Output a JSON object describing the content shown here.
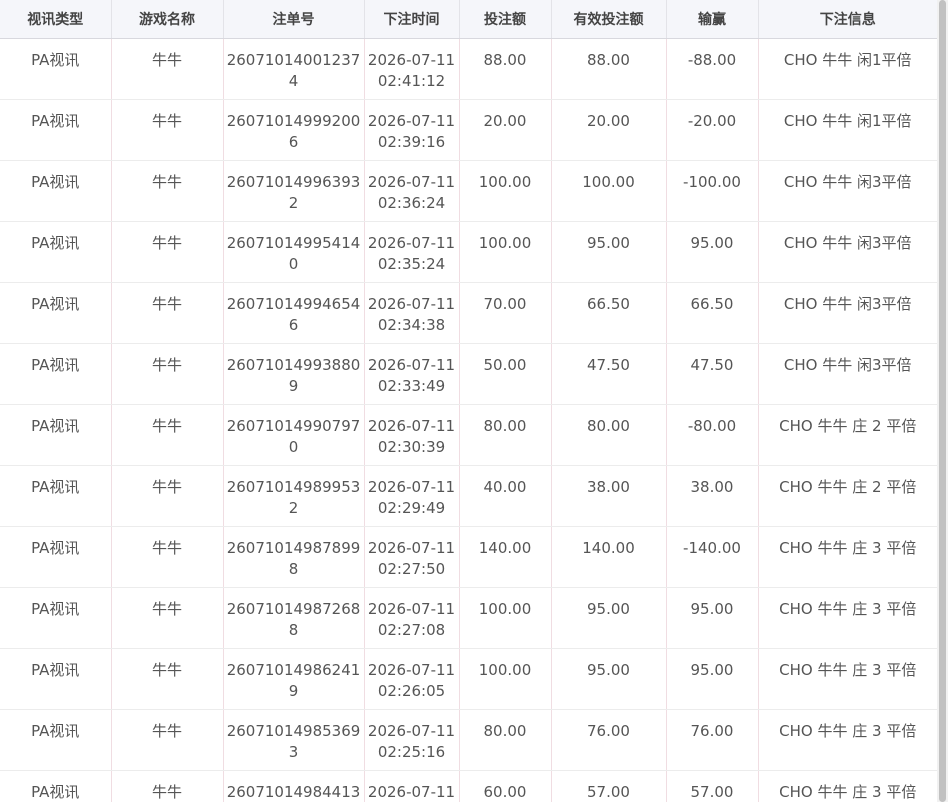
{
  "columns": [
    "视讯类型",
    "游戏名称",
    "注单号",
    "下注时间",
    "投注额",
    "有效投注额",
    "输赢",
    "下注信息"
  ],
  "rows": [
    {
      "type": "PA视讯",
      "game": "牛牛",
      "bet_id": "260710140012374",
      "time": "2026-07-11 02:41:12",
      "amount": "88.00",
      "valid": "88.00",
      "winloss": "-88.00",
      "info": "CHO 牛牛 闲1平倍"
    },
    {
      "type": "PA视讯",
      "game": "牛牛",
      "bet_id": "260710149992006",
      "time": "2026-07-11 02:39:16",
      "amount": "20.00",
      "valid": "20.00",
      "winloss": "-20.00",
      "info": "CHO 牛牛 闲1平倍"
    },
    {
      "type": "PA视讯",
      "game": "牛牛",
      "bet_id": "260710149963932",
      "time": "2026-07-11 02:36:24",
      "amount": "100.00",
      "valid": "100.00",
      "winloss": "-100.00",
      "info": "CHO 牛牛 闲3平倍"
    },
    {
      "type": "PA视讯",
      "game": "牛牛",
      "bet_id": "260710149954140",
      "time": "2026-07-11 02:35:24",
      "amount": "100.00",
      "valid": "95.00",
      "winloss": "95.00",
      "info": "CHO 牛牛 闲3平倍"
    },
    {
      "type": "PA视讯",
      "game": "牛牛",
      "bet_id": "260710149946546",
      "time": "2026-07-11 02:34:38",
      "amount": "70.00",
      "valid": "66.50",
      "winloss": "66.50",
      "info": "CHO 牛牛 闲3平倍"
    },
    {
      "type": "PA视讯",
      "game": "牛牛",
      "bet_id": "260710149938809",
      "time": "2026-07-11 02:33:49",
      "amount": "50.00",
      "valid": "47.50",
      "winloss": "47.50",
      "info": "CHO 牛牛 闲3平倍"
    },
    {
      "type": "PA视讯",
      "game": "牛牛",
      "bet_id": "260710149907970",
      "time": "2026-07-11 02:30:39",
      "amount": "80.00",
      "valid": "80.00",
      "winloss": "-80.00",
      "info": "CHO 牛牛 庄 2 平倍"
    },
    {
      "type": "PA视讯",
      "game": "牛牛",
      "bet_id": "260710149899532",
      "time": "2026-07-11 02:29:49",
      "amount": "40.00",
      "valid": "38.00",
      "winloss": "38.00",
      "info": "CHO 牛牛 庄 2 平倍"
    },
    {
      "type": "PA视讯",
      "game": "牛牛",
      "bet_id": "260710149878998",
      "time": "2026-07-11 02:27:50",
      "amount": "140.00",
      "valid": "140.00",
      "winloss": "-140.00",
      "info": "CHO 牛牛 庄 3 平倍"
    },
    {
      "type": "PA视讯",
      "game": "牛牛",
      "bet_id": "260710149872688",
      "time": "2026-07-11 02:27:08",
      "amount": "100.00",
      "valid": "95.00",
      "winloss": "95.00",
      "info": "CHO 牛牛 庄 3 平倍"
    },
    {
      "type": "PA视讯",
      "game": "牛牛",
      "bet_id": "260710149862419",
      "time": "2026-07-11 02:26:05",
      "amount": "100.00",
      "valid": "95.00",
      "winloss": "95.00",
      "info": "CHO 牛牛 庄 3 平倍"
    },
    {
      "type": "PA视讯",
      "game": "牛牛",
      "bet_id": "260710149853693",
      "time": "2026-07-11 02:25:16",
      "amount": "80.00",
      "valid": "76.00",
      "winloss": "76.00",
      "info": "CHO 牛牛 庄 3 平倍"
    },
    {
      "type": "PA视讯",
      "game": "牛牛",
      "bet_id": "26071014984413",
      "time": "2026-07-11",
      "amount": "60.00",
      "valid": "57.00",
      "winloss": "57.00",
      "info": "CHO 牛牛 庄 3 平倍"
    }
  ]
}
